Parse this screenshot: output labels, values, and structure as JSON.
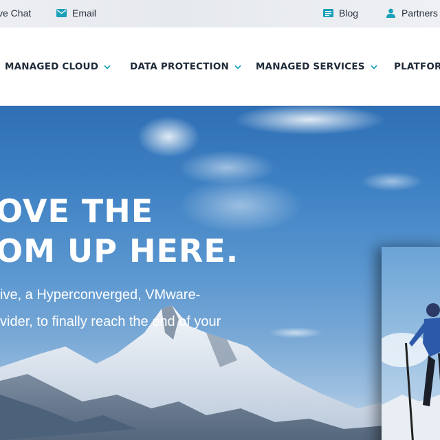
{
  "topbar": {
    "live_chat": "ve Chat",
    "email": "Email",
    "blog": "Blog",
    "partners": "Partners"
  },
  "nav": {
    "items": [
      {
        "label": "MANAGED CLOUD"
      },
      {
        "label": "DATA PROTECTION"
      },
      {
        "label": "MANAGED SERVICES"
      },
      {
        "label": "PLATFORM"
      }
    ]
  },
  "hero": {
    "headline_line1": "OVE THE",
    "headline_line2": "OM UP HERE.",
    "sub_line1": "ive, a Hyperconverged, VMware-",
    "sub_line2": "vider, to finally reach the end of your"
  },
  "colors": {
    "accent": "#1aa0b8",
    "nav_text": "#1e2a38"
  }
}
